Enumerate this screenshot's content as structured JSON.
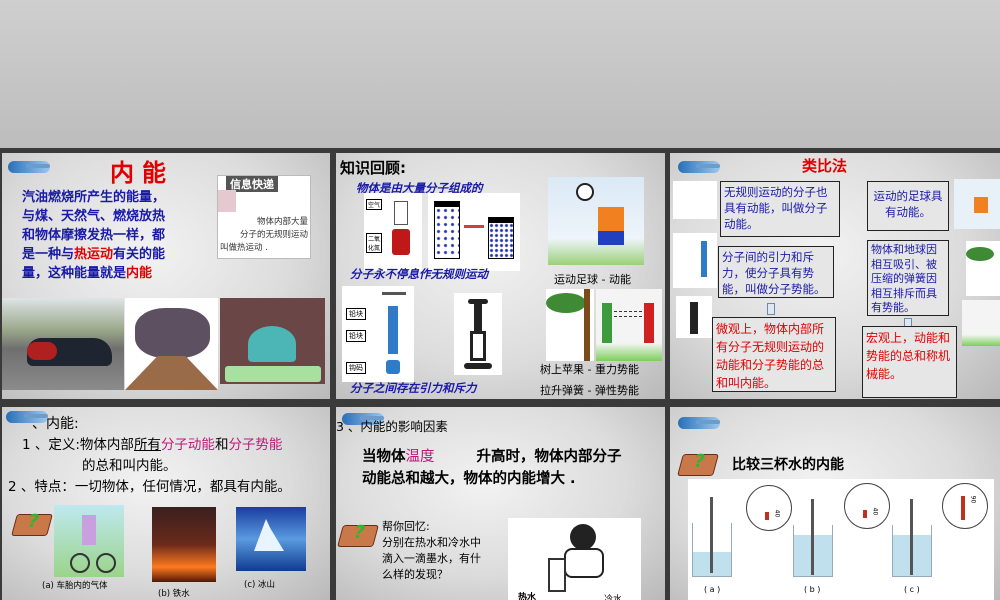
{
  "slide1": {
    "title": "内能",
    "para": [
      "汽油燃烧所产生的能量，",
      "与煤、天然气、燃烧放热",
      "和物体摩擦发热一样，都"
    ],
    "line4_a": "是一种与",
    "line4_red": "热运动",
    "line4_b": "有关的能",
    "line5_a": "量，这种能量就是",
    "line5_red": "内能",
    "info_title": "信息快递",
    "info_text": [
      "物体内部大量",
      "分子的无规则运动",
      "叫做热运动 ."
    ]
  },
  "slide2": {
    "title": "知识回顾:",
    "s1": "物体是由大量分子组成的",
    "s2": "分子永不停息作无规则运动",
    "s3": "分子之间存在引力和斥力",
    "c1": "运动足球 - 动能",
    "c2": "树上苹果 - 重力势能",
    "c3": "拉升弹簧 - 弹性势能",
    "labels": [
      "空气",
      "二氧化氮",
      "铅块",
      "铅块",
      "钩码"
    ]
  },
  "slide3": {
    "title": "类比法",
    "b1": "无规则运动的分子也具有动能，叫做分子动能。",
    "b2": "分子间的引力和斥力，使分子具有势能，叫做分子势能。",
    "b3": "微观上，物体内部所有分子无规则运动的动能和分子势能的总和叫内能。",
    "b4": "运动的足球具有动能。",
    "b5": "物体和地球因相互吸引、被压缩的弹簧因相互排斥而具有势能。",
    "b6": "宏观上，动能和势能的总和称机械能。"
  },
  "slide4": {
    "heading": "、内能:",
    "def_a": "1 、定义:物体内部",
    "def_u": "所有",
    "def_p1": "分子动能",
    "def_and": "和",
    "def_p2": "分子势能",
    "def_b": "的总和叫内能。",
    "feat": "2 、特点：一切物体，任何情况，都具有内能。",
    "cap_a": "(a) 车胎内的气体",
    "cap_b": "(b) 铁水",
    "cap_c": "(c) 冰山"
  },
  "slide5": {
    "heading": "3 、内能的影响因素",
    "l1_a": "当物体",
    "l1_pink": "温度",
    "l1_b": "升高时，物体内部分子",
    "l2": "动能总和越大，物体的内能增大 .",
    "help": [
      "帮你回忆:",
      "分别在热水和冷水中",
      "滴入一滴墨水，有什",
      "么样的发现？"
    ],
    "hot": "热水",
    "cold": "冷水"
  },
  "slide6": {
    "title": "比较三杯水的内能",
    "caps": [
      "( a )",
      "( b )",
      "( c )"
    ],
    "therm": [
      "40",
      "40",
      "90"
    ]
  }
}
